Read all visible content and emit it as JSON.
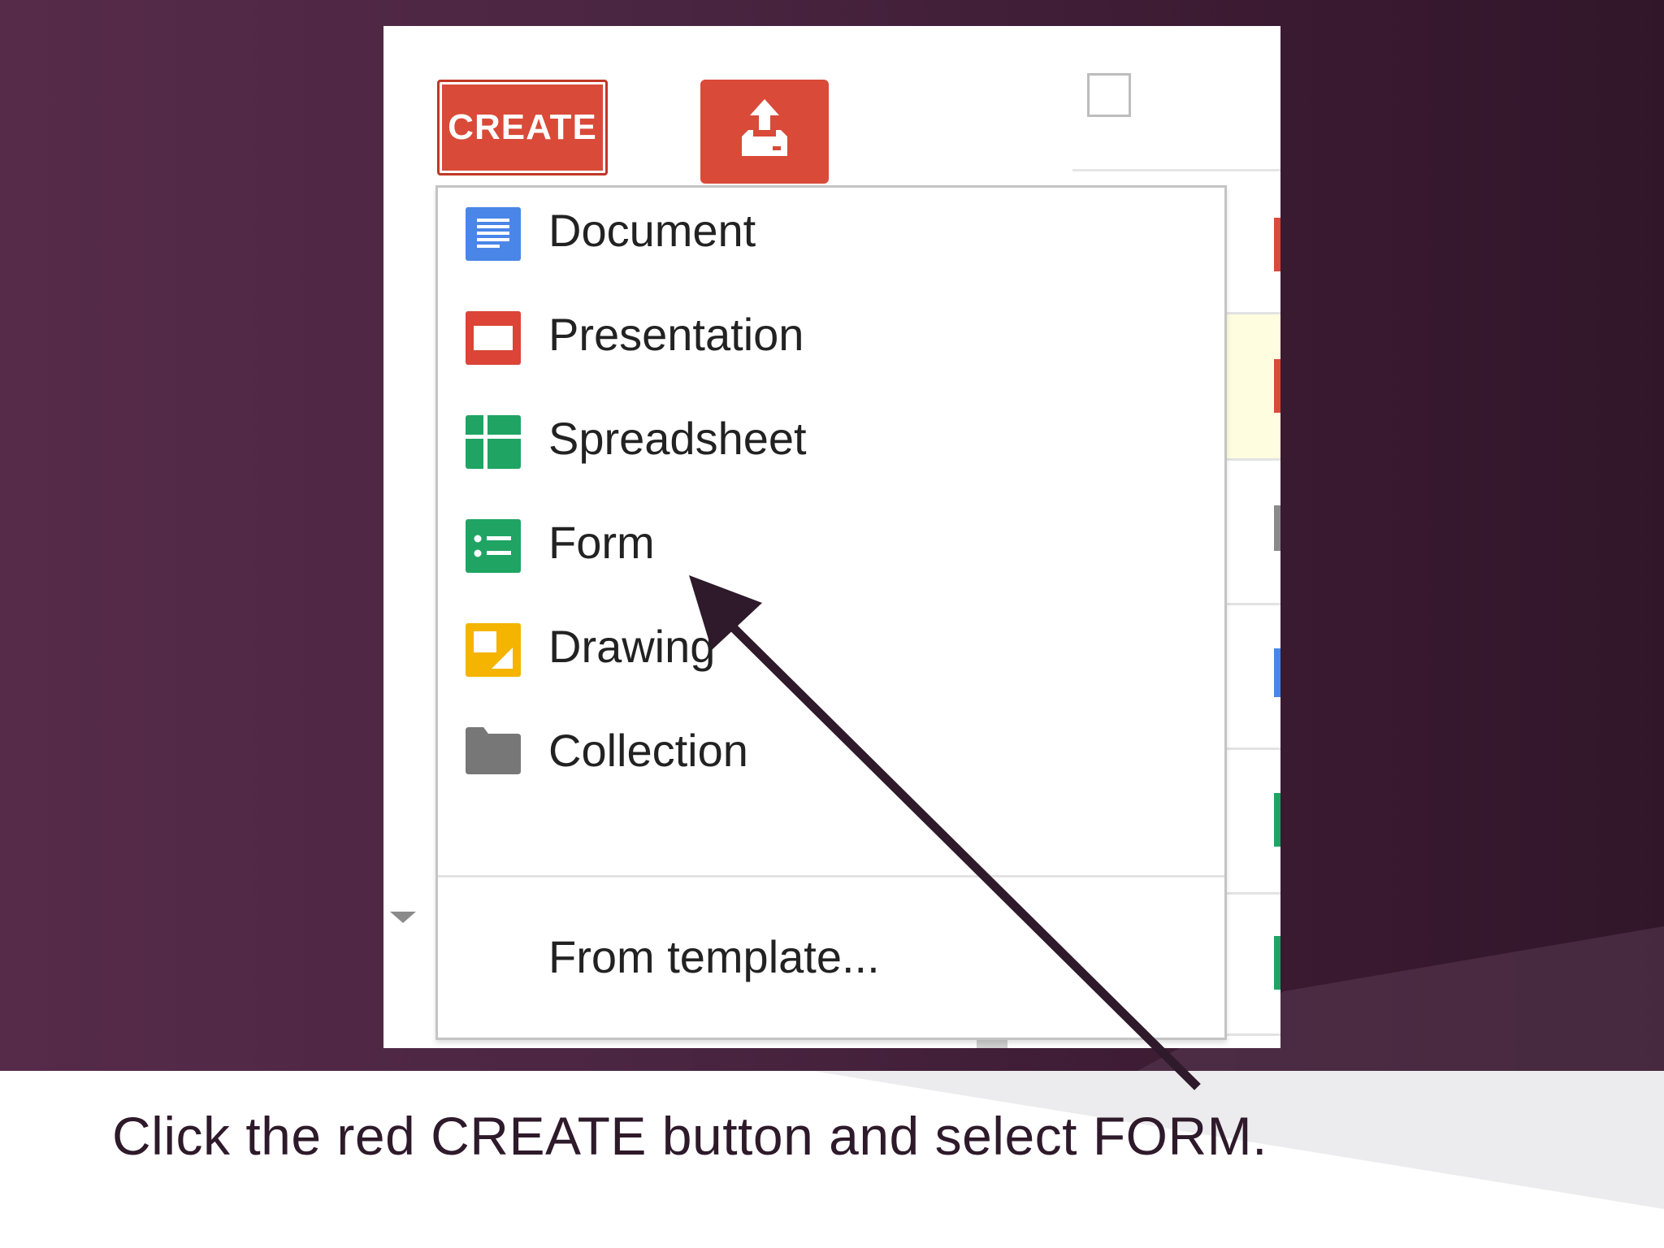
{
  "toolbar": {
    "create_label": "CREATE",
    "upload_icon": "upload-icon"
  },
  "menu": {
    "items": [
      {
        "label": "Document",
        "icon": "document-icon",
        "color": "#4a86e8"
      },
      {
        "label": "Presentation",
        "icon": "presentation-icon",
        "color": "#db4437"
      },
      {
        "label": "Spreadsheet",
        "icon": "spreadsheet-icon",
        "color": "#1fa463"
      },
      {
        "label": "Form",
        "icon": "form-icon",
        "color": "#1fa463"
      },
      {
        "label": "Drawing",
        "icon": "drawing-icon",
        "color": "#f4b400"
      },
      {
        "label": "Collection",
        "icon": "folder-icon",
        "color": "#777777"
      }
    ],
    "template_label": "From template..."
  },
  "caption": "Click the red CREATE button and select FORM.",
  "colors": {
    "create_red": "#d94a38",
    "backdrop": "#4a2541",
    "arrow": "#2e1a2a"
  }
}
